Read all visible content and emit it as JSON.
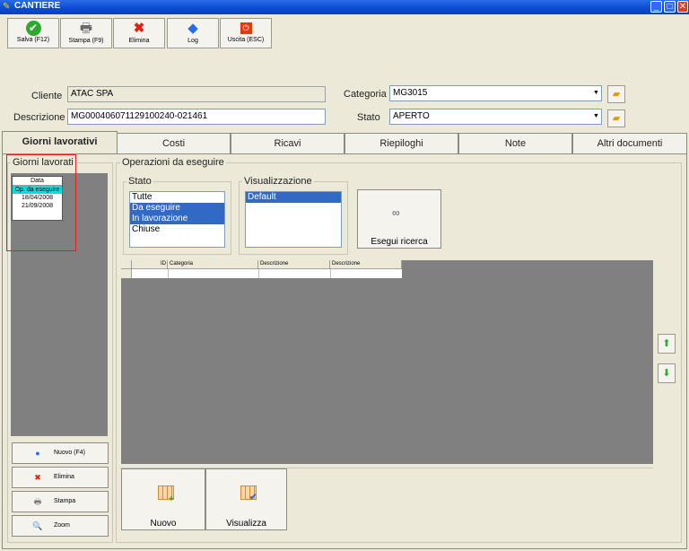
{
  "window": {
    "title": "CANTIERE"
  },
  "toolbar": {
    "save_label": "Salva (F12)",
    "print_label": "Stampa (F9)",
    "delete_label": "Elimina",
    "log_label": "Log",
    "exit_label": "Uscita (ESC)"
  },
  "header": {
    "cliente_label": "Cliente",
    "cliente_value": "ATAC SPA",
    "descrizione_label": "Descrizione",
    "descrizione_value": "MG00040607112910024​0-021461",
    "categoria_label": "Categoria :",
    "categoria_value": "MG3015",
    "stato_label": "Stato",
    "stato_value": "APERTO"
  },
  "tabs": [
    {
      "label": "Giorni lavorativi"
    },
    {
      "label": "Costi"
    },
    {
      "label": "Ricavi"
    },
    {
      "label": "Riepiloghi"
    },
    {
      "label": "Note"
    },
    {
      "label": "Altri documenti"
    }
  ],
  "giorni": {
    "group_label": "Giorni lavorati",
    "list_header": "Data",
    "items": [
      "Op. da eseguire",
      "18/04/2008",
      "21/09/2008"
    ],
    "new_label": "Nuovo (F4)",
    "delete_label": "Elimina",
    "print_label": "Stampa",
    "zoom_label": "Zoom"
  },
  "operazioni": {
    "group_label": "Operazioni da eseguire",
    "stato_label": "Stato",
    "stato_items": [
      "Tutte",
      "Da eseguire",
      "In lavorazione",
      "Chiuse"
    ],
    "visualizzazione_label": "Visualizzazione",
    "visualizzazione_items": [
      "Default"
    ],
    "search_label": "Esegui ricerca",
    "grid_headers": [
      "ID",
      "Categoria",
      "Descrizione",
      "Descrizione"
    ],
    "new_label": "Nuovo",
    "view_label": "Visualizza"
  }
}
